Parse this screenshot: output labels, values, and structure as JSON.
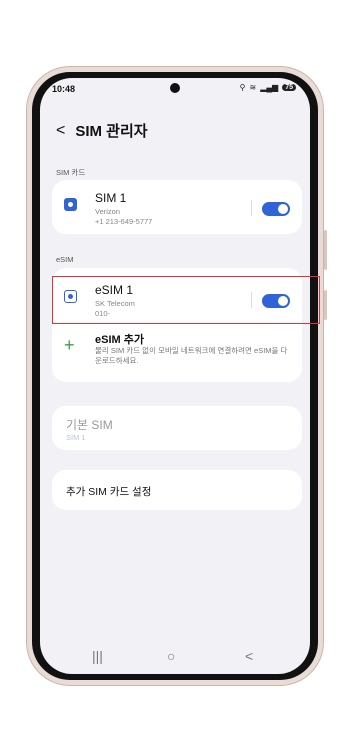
{
  "status": {
    "time": "10:48",
    "battery": "75"
  },
  "header": {
    "title": "SIM 관리자"
  },
  "sections": {
    "sim_card": "SIM 카드",
    "esim": "eSIM"
  },
  "sim1": {
    "name": "SIM 1",
    "carrier": "Verizon",
    "number": "+1 213-649-5777"
  },
  "esim1": {
    "name": "eSIM 1",
    "carrier": "SK Telecom",
    "number": "010-"
  },
  "add_esim": {
    "title": "eSIM 추가",
    "desc": "물리 SIM 카드 없이 모바일 네트워크에 연결하려면 eSIM을 다운로드하세요."
  },
  "default_sim": {
    "label": "기본 SIM",
    "value": "SIM 1"
  },
  "extra_settings": {
    "label": "추가 SIM 카드 설정"
  },
  "nav": {
    "recent": "|||",
    "home": "○",
    "back": "<"
  },
  "colors": {
    "accent": "#2f63d7",
    "add": "#3a9d4d",
    "highlight": "#e0323c"
  }
}
